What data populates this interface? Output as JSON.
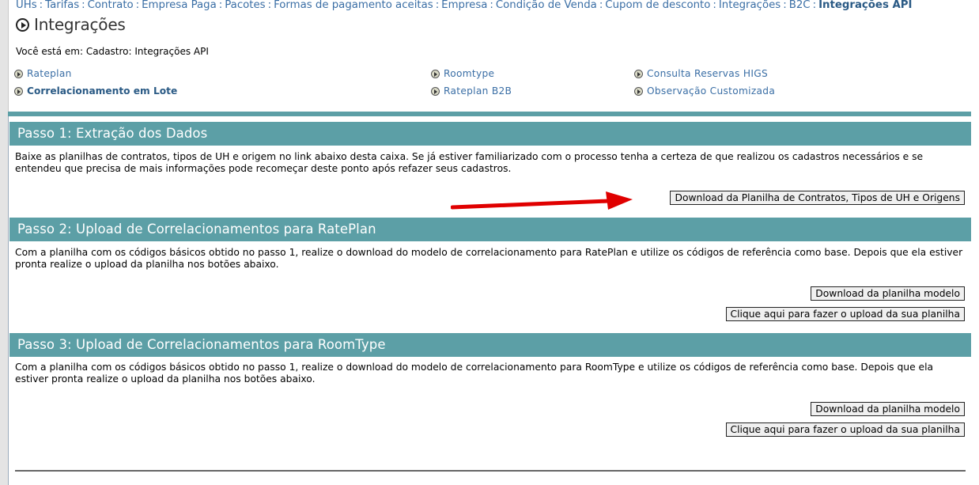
{
  "nav": {
    "items": [
      "UHs",
      "Tarifas",
      "Contrato",
      "Empresa Paga",
      "Pacotes",
      "Formas de pagamento aceitas",
      "Empresa",
      "Condição de Venda",
      "Cupom de desconto",
      "Integrações",
      "B2C",
      "Integrações API"
    ],
    "active": "Integrações API",
    "separator": ":"
  },
  "page": {
    "title": "Integrações",
    "breadcrumb": "Você está em: Cadastro: Integrações API"
  },
  "links": {
    "rateplan": "Rateplan",
    "correlacionamento": "Correlacionamento em Lote",
    "roomtype": "Roomtype",
    "rateplan_b2b": "Rateplan B2B",
    "consulta": "Consulta Reservas HIGS",
    "observacao": "Observação Customizada"
  },
  "step1": {
    "title": "Passo 1: Extração dos Dados",
    "text": "Baixe as planilhas de contratos, tipos de UH e origem no link abaixo desta caixa. Se já estiver familiarizado com o processo tenha a certeza de que realizou os cadastros necessários e se entendeu que precisa de mais informações pode recomeçar deste ponto após refazer seus cadastros.",
    "button": "Download da Planilha de Contratos, Tipos de UH e Origens"
  },
  "step2": {
    "title": "Passo 2: Upload de Correlacionamentos para RatePlan",
    "text": "Com a planilha com os códigos básicos obtido no passo 1, realize o download do modelo de correlacionamento para RatePlan e utilize os códigos de referência como base. Depois que ela estiver pronta realize o upload da planilha nos botões abaixo.",
    "download_button": "Download da planilha modelo",
    "upload_button": "Clique aqui para fazer o upload da sua planilha"
  },
  "step3": {
    "title": "Passo 3: Upload de Correlacionamentos para RoomType",
    "text": "Com a planilha com os códigos básicos obtido no passo 1, realize o download do modelo de correlacionamento para RoomType e utilize os códigos de referência como base. Depois que ela estiver pronta realize o upload da planilha nos botões abaixo.",
    "download_button": "Download da planilha modelo",
    "upload_button": "Clique aqui para fazer o upload da sua planilha"
  },
  "colors": {
    "header_bg": "#5c9fa6",
    "link": "#3a6ea5",
    "annotation_arrow": "#e00000"
  },
  "icons": {
    "title": "circle-arrow-icon",
    "links": "circle-arrow-icon",
    "annotation": "red-arrow-icon"
  }
}
